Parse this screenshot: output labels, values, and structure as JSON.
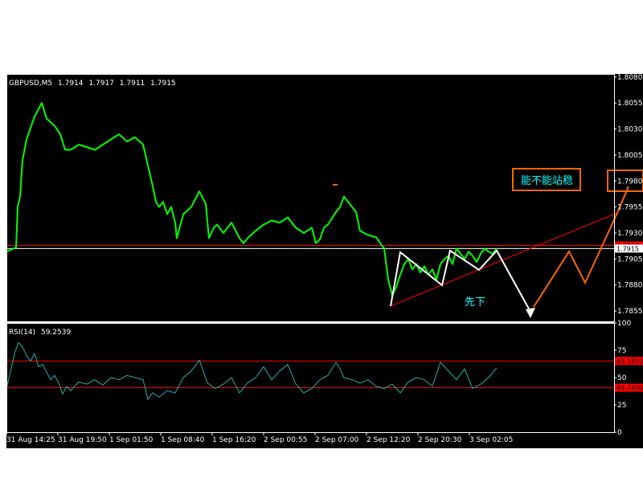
{
  "chart_data": [
    {
      "type": "line",
      "panel": "price",
      "title": "GBPUSD,M5",
      "ohlc": [
        "1.7914",
        "1.7917",
        "1.7911",
        "1.7915"
      ],
      "ylim": [
        1.7845,
        1.8083
      ],
      "yticks": [
        "1.8080",
        "1.8055",
        "1.8030",
        "1.8005",
        "1.7980",
        "1.7955",
        "1.7930",
        "1.7905",
        "1.7880",
        "1.7855"
      ],
      "ytick_values": [
        1.808,
        1.8055,
        1.803,
        1.8005,
        1.798,
        1.7955,
        1.793,
        1.7905,
        1.788,
        1.7855
      ],
      "series": [
        {
          "color": "#00ff00",
          "x": [
            0,
            12,
            14,
            17,
            20,
            25,
            35,
            44,
            50,
            60,
            67,
            73,
            80,
            90,
            110,
            130,
            140,
            150,
            160,
            170,
            176,
            182,
            186,
            190,
            195,
            200,
            205,
            210,
            212,
            220,
            230,
            240,
            248,
            252,
            258,
            262,
            270,
            280,
            290,
            295,
            300,
            310,
            320,
            330,
            340,
            350,
            360,
            370,
            380,
            385,
            390,
            395,
            400,
            410,
            415,
            420,
            425,
            430,
            435,
            440,
            450,
            460,
            465,
            470,
            475,
            480,
            485,
            490,
            495,
            500
          ],
          "values": [
            1.7912,
            1.7916,
            1.7955,
            1.7965,
            1.8,
            1.802,
            1.8042,
            1.8055,
            1.804,
            1.8033,
            1.8025,
            1.801,
            1.801,
            1.8015,
            1.801,
            1.802,
            1.8025,
            1.8018,
            1.8022,
            1.8015,
            1.7995,
            1.7975,
            1.796,
            1.7955,
            1.796,
            1.7948,
            1.7955,
            1.794,
            1.7925,
            1.7948,
            1.7955,
            1.797,
            1.7958,
            1.7925,
            1.7935,
            1.7938,
            1.793,
            1.794,
            1.7925,
            1.792,
            1.7925,
            1.7932,
            1.7938,
            1.7942,
            1.794,
            1.7945,
            1.7935,
            1.793,
            1.7935,
            1.792,
            1.7924,
            1.7935,
            1.7938,
            1.795,
            1.7955,
            1.7965,
            1.796,
            1.7955,
            1.795,
            1.7932,
            1.7928,
            1.7926,
            1.792,
            1.7915,
            1.7885,
            1.787,
            1.7878,
            1.789,
            1.79,
            1.7905
          ]
        },
        {
          "color": "#00ff00",
          "x": [
            500,
            505,
            510,
            515,
            520,
            525,
            530,
            535,
            540,
            545,
            550,
            555,
            560,
            565,
            570,
            575,
            580,
            585,
            590,
            595,
            600,
            605,
            610
          ],
          "values": [
            1.7905,
            1.7895,
            1.79,
            1.7892,
            1.7898,
            1.789,
            1.7895,
            1.7885,
            1.79,
            1.7905,
            1.7908,
            1.79,
            1.7915,
            1.791,
            1.7905,
            1.7912,
            1.7908,
            1.7902,
            1.791,
            1.7915,
            1.7912,
            1.791,
            1.7915
          ]
        }
      ],
      "hlines": [
        {
          "value": 1.7918,
          "color": "#ff0000",
          "label": "1.7918"
        },
        {
          "value": 1.7915,
          "color": "#ffffff",
          "label": "1.7915"
        }
      ],
      "annotations": [
        {
          "text": "能不能站稳",
          "color": "#00ffff",
          "border": "#ff6600"
        },
        {
          "text": "先下",
          "color": "#00ffff"
        }
      ]
    },
    {
      "type": "line",
      "panel": "rsi",
      "title": "RSI(14)",
      "current": "59.2539",
      "ylim": [
        0,
        100
      ],
      "yticks": [
        "100",
        "75",
        "50",
        "25",
        "0"
      ],
      "ytick_values": [
        100,
        75,
        50,
        25,
        0
      ],
      "series": [
        {
          "color": "#20b2aa",
          "x": [
            0,
            5,
            10,
            15,
            20,
            25,
            30,
            35,
            40,
            45,
            50,
            55,
            60,
            65,
            70,
            75,
            80,
            90,
            100,
            110,
            120,
            130,
            140,
            150,
            160,
            170,
            176,
            182,
            190,
            200,
            210,
            220,
            230,
            240,
            250,
            260,
            270,
            280,
            290,
            300,
            310,
            320,
            330,
            340,
            350,
            360,
            370,
            380,
            390,
            400,
            410,
            415,
            420,
            430,
            440,
            450,
            460,
            470,
            480,
            490,
            500,
            510,
            520,
            530,
            540,
            550,
            560,
            570,
            580,
            590,
            600,
            610
          ],
          "values": [
            40,
            55,
            72,
            82,
            78,
            70,
            65,
            72,
            60,
            62,
            55,
            48,
            52,
            45,
            35,
            42,
            38,
            46,
            44,
            48,
            43,
            50,
            48,
            52,
            50,
            48,
            30,
            36,
            32,
            38,
            36,
            50,
            56,
            66,
            45,
            40,
            44,
            50,
            36,
            45,
            50,
            60,
            48,
            56,
            62,
            44,
            36,
            40,
            48,
            52,
            64,
            58,
            50,
            48,
            45,
            48,
            42,
            40,
            44,
            36,
            46,
            50,
            48,
            42,
            64,
            56,
            48,
            58,
            40,
            44,
            50,
            59
          ]
        }
      ],
      "hlines": [
        {
          "value": 65.185,
          "color": "#ff0000",
          "label": "65.1850"
        },
        {
          "value": 40.74,
          "color": "#ff0000",
          "label": "40.7400"
        }
      ]
    }
  ],
  "xaxis": {
    "labels": [
      "31 Aug 14:25",
      "31 Aug 19:50",
      "1 Sep 01:50",
      "1 Sep 08:40",
      "1 Sep 16:20",
      "2 Sep 00:55",
      "2 Sep 07:00",
      "2 Sep 12:20",
      "2 Sep 20:30",
      "3 Sep 02:05"
    ],
    "positions": [
      0,
      64,
      128,
      192,
      256,
      320,
      384,
      448,
      512,
      576
    ]
  },
  "colors": {
    "background": "#000000",
    "frame": "#ffffff",
    "price": "#00ff00",
    "rsi": "#20b2aa",
    "support": "#ff0000",
    "forecast": "#ff6600",
    "pattern": "#ffffff"
  }
}
